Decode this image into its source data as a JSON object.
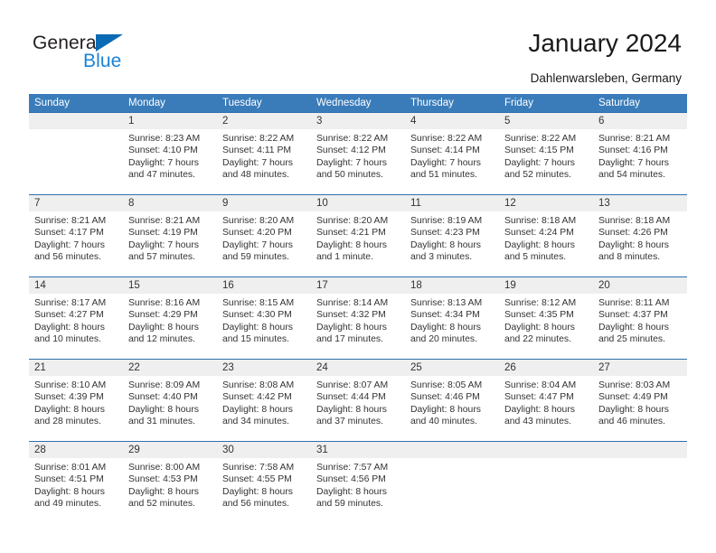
{
  "brand": {
    "name_part1": "General",
    "name_part2": "Blue",
    "triangle_icon": "blue-triangle-icon",
    "color_dark": "#231f20",
    "color_blue": "#1a83d6"
  },
  "header": {
    "title": "January 2024",
    "subtitle": "Dahlenwarsleben, Germany",
    "header_bg_color": "#3a7cba",
    "daynum_bg_color": "#efefef"
  },
  "weekdays": [
    "Sunday",
    "Monday",
    "Tuesday",
    "Wednesday",
    "Thursday",
    "Friday",
    "Saturday"
  ],
  "weeks": [
    [
      {
        "day": "",
        "sunrise": "",
        "sunset": "",
        "daylight1": "",
        "daylight2": ""
      },
      {
        "day": "1",
        "sunrise": "Sunrise: 8:23 AM",
        "sunset": "Sunset: 4:10 PM",
        "daylight1": "Daylight: 7 hours",
        "daylight2": "and 47 minutes."
      },
      {
        "day": "2",
        "sunrise": "Sunrise: 8:22 AM",
        "sunset": "Sunset: 4:11 PM",
        "daylight1": "Daylight: 7 hours",
        "daylight2": "and 48 minutes."
      },
      {
        "day": "3",
        "sunrise": "Sunrise: 8:22 AM",
        "sunset": "Sunset: 4:12 PM",
        "daylight1": "Daylight: 7 hours",
        "daylight2": "and 50 minutes."
      },
      {
        "day": "4",
        "sunrise": "Sunrise: 8:22 AM",
        "sunset": "Sunset: 4:14 PM",
        "daylight1": "Daylight: 7 hours",
        "daylight2": "and 51 minutes."
      },
      {
        "day": "5",
        "sunrise": "Sunrise: 8:22 AM",
        "sunset": "Sunset: 4:15 PM",
        "daylight1": "Daylight: 7 hours",
        "daylight2": "and 52 minutes."
      },
      {
        "day": "6",
        "sunrise": "Sunrise: 8:21 AM",
        "sunset": "Sunset: 4:16 PM",
        "daylight1": "Daylight: 7 hours",
        "daylight2": "and 54 minutes."
      }
    ],
    [
      {
        "day": "7",
        "sunrise": "Sunrise: 8:21 AM",
        "sunset": "Sunset: 4:17 PM",
        "daylight1": "Daylight: 7 hours",
        "daylight2": "and 56 minutes."
      },
      {
        "day": "8",
        "sunrise": "Sunrise: 8:21 AM",
        "sunset": "Sunset: 4:19 PM",
        "daylight1": "Daylight: 7 hours",
        "daylight2": "and 57 minutes."
      },
      {
        "day": "9",
        "sunrise": "Sunrise: 8:20 AM",
        "sunset": "Sunset: 4:20 PM",
        "daylight1": "Daylight: 7 hours",
        "daylight2": "and 59 minutes."
      },
      {
        "day": "10",
        "sunrise": "Sunrise: 8:20 AM",
        "sunset": "Sunset: 4:21 PM",
        "daylight1": "Daylight: 8 hours",
        "daylight2": "and 1 minute."
      },
      {
        "day": "11",
        "sunrise": "Sunrise: 8:19 AM",
        "sunset": "Sunset: 4:23 PM",
        "daylight1": "Daylight: 8 hours",
        "daylight2": "and 3 minutes."
      },
      {
        "day": "12",
        "sunrise": "Sunrise: 8:18 AM",
        "sunset": "Sunset: 4:24 PM",
        "daylight1": "Daylight: 8 hours",
        "daylight2": "and 5 minutes."
      },
      {
        "day": "13",
        "sunrise": "Sunrise: 8:18 AM",
        "sunset": "Sunset: 4:26 PM",
        "daylight1": "Daylight: 8 hours",
        "daylight2": "and 8 minutes."
      }
    ],
    [
      {
        "day": "14",
        "sunrise": "Sunrise: 8:17 AM",
        "sunset": "Sunset: 4:27 PM",
        "daylight1": "Daylight: 8 hours",
        "daylight2": "and 10 minutes."
      },
      {
        "day": "15",
        "sunrise": "Sunrise: 8:16 AM",
        "sunset": "Sunset: 4:29 PM",
        "daylight1": "Daylight: 8 hours",
        "daylight2": "and 12 minutes."
      },
      {
        "day": "16",
        "sunrise": "Sunrise: 8:15 AM",
        "sunset": "Sunset: 4:30 PM",
        "daylight1": "Daylight: 8 hours",
        "daylight2": "and 15 minutes."
      },
      {
        "day": "17",
        "sunrise": "Sunrise: 8:14 AM",
        "sunset": "Sunset: 4:32 PM",
        "daylight1": "Daylight: 8 hours",
        "daylight2": "and 17 minutes."
      },
      {
        "day": "18",
        "sunrise": "Sunrise: 8:13 AM",
        "sunset": "Sunset: 4:34 PM",
        "daylight1": "Daylight: 8 hours",
        "daylight2": "and 20 minutes."
      },
      {
        "day": "19",
        "sunrise": "Sunrise: 8:12 AM",
        "sunset": "Sunset: 4:35 PM",
        "daylight1": "Daylight: 8 hours",
        "daylight2": "and 22 minutes."
      },
      {
        "day": "20",
        "sunrise": "Sunrise: 8:11 AM",
        "sunset": "Sunset: 4:37 PM",
        "daylight1": "Daylight: 8 hours",
        "daylight2": "and 25 minutes."
      }
    ],
    [
      {
        "day": "21",
        "sunrise": "Sunrise: 8:10 AM",
        "sunset": "Sunset: 4:39 PM",
        "daylight1": "Daylight: 8 hours",
        "daylight2": "and 28 minutes."
      },
      {
        "day": "22",
        "sunrise": "Sunrise: 8:09 AM",
        "sunset": "Sunset: 4:40 PM",
        "daylight1": "Daylight: 8 hours",
        "daylight2": "and 31 minutes."
      },
      {
        "day": "23",
        "sunrise": "Sunrise: 8:08 AM",
        "sunset": "Sunset: 4:42 PM",
        "daylight1": "Daylight: 8 hours",
        "daylight2": "and 34 minutes."
      },
      {
        "day": "24",
        "sunrise": "Sunrise: 8:07 AM",
        "sunset": "Sunset: 4:44 PM",
        "daylight1": "Daylight: 8 hours",
        "daylight2": "and 37 minutes."
      },
      {
        "day": "25",
        "sunrise": "Sunrise: 8:05 AM",
        "sunset": "Sunset: 4:46 PM",
        "daylight1": "Daylight: 8 hours",
        "daylight2": "and 40 minutes."
      },
      {
        "day": "26",
        "sunrise": "Sunrise: 8:04 AM",
        "sunset": "Sunset: 4:47 PM",
        "daylight1": "Daylight: 8 hours",
        "daylight2": "and 43 minutes."
      },
      {
        "day": "27",
        "sunrise": "Sunrise: 8:03 AM",
        "sunset": "Sunset: 4:49 PM",
        "daylight1": "Daylight: 8 hours",
        "daylight2": "and 46 minutes."
      }
    ],
    [
      {
        "day": "28",
        "sunrise": "Sunrise: 8:01 AM",
        "sunset": "Sunset: 4:51 PM",
        "daylight1": "Daylight: 8 hours",
        "daylight2": "and 49 minutes."
      },
      {
        "day": "29",
        "sunrise": "Sunrise: 8:00 AM",
        "sunset": "Sunset: 4:53 PM",
        "daylight1": "Daylight: 8 hours",
        "daylight2": "and 52 minutes."
      },
      {
        "day": "30",
        "sunrise": "Sunrise: 7:58 AM",
        "sunset": "Sunset: 4:55 PM",
        "daylight1": "Daylight: 8 hours",
        "daylight2": "and 56 minutes."
      },
      {
        "day": "31",
        "sunrise": "Sunrise: 7:57 AM",
        "sunset": "Sunset: 4:56 PM",
        "daylight1": "Daylight: 8 hours",
        "daylight2": "and 59 minutes."
      },
      {
        "day": "",
        "sunrise": "",
        "sunset": "",
        "daylight1": "",
        "daylight2": ""
      },
      {
        "day": "",
        "sunrise": "",
        "sunset": "",
        "daylight1": "",
        "daylight2": ""
      },
      {
        "day": "",
        "sunrise": "",
        "sunset": "",
        "daylight1": "",
        "daylight2": ""
      }
    ]
  ]
}
